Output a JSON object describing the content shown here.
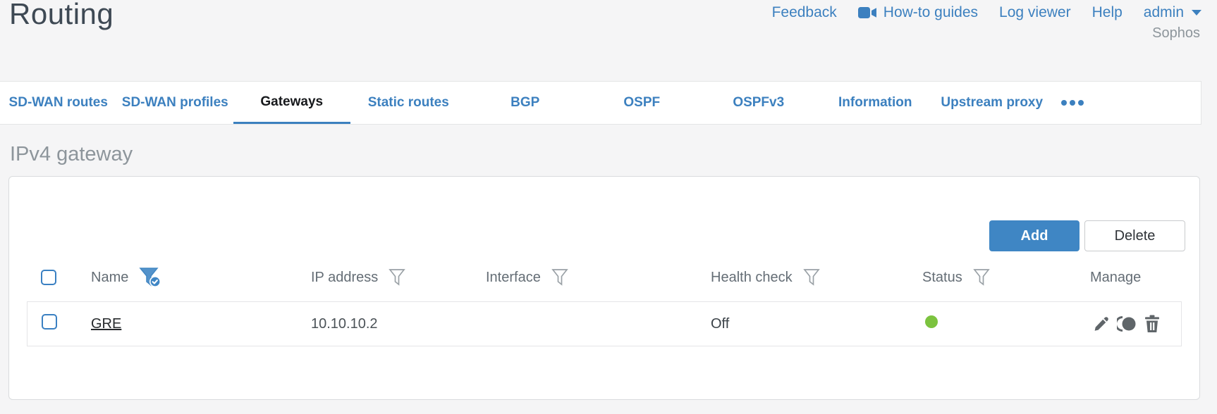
{
  "header": {
    "title": "Routing",
    "nav": {
      "feedback": "Feedback",
      "howto": "How-to guides",
      "log_viewer": "Log viewer",
      "help": "Help",
      "user": "admin",
      "brand": "Sophos"
    }
  },
  "tabs": {
    "items": [
      {
        "label": "SD-WAN routes"
      },
      {
        "label": "SD-WAN profiles"
      },
      {
        "label": "Gateways",
        "active": true
      },
      {
        "label": "Static routes"
      },
      {
        "label": "BGP"
      },
      {
        "label": "OSPF"
      },
      {
        "label": "OSPFv3"
      },
      {
        "label": "Information"
      },
      {
        "label": "Upstream proxy"
      }
    ]
  },
  "section": {
    "title": "IPv4 gateway"
  },
  "toolbar": {
    "add_label": "Add",
    "delete_label": "Delete"
  },
  "table": {
    "columns": {
      "name": "Name",
      "ip": "IP address",
      "interface": "Interface",
      "health": "Health check",
      "status": "Status",
      "manage": "Manage"
    },
    "rows": [
      {
        "name": "GRE",
        "ip_address": "10.10.10.2",
        "interface": "",
        "health_check": "Off",
        "status": "up"
      }
    ]
  },
  "colors": {
    "accent_blue": "#3c80bf",
    "button_blue": "#3f86c4",
    "status_up_green": "#7cc33f",
    "title_gray": "#8d959b",
    "icon_gray": "#5f6569"
  },
  "icons": {
    "name_filter": "filter-applied-icon",
    "column_filter": "filter-icon",
    "row_actions": [
      "edit-pencil-icon",
      "toggle-active-icon",
      "delete-trash-icon"
    ]
  }
}
